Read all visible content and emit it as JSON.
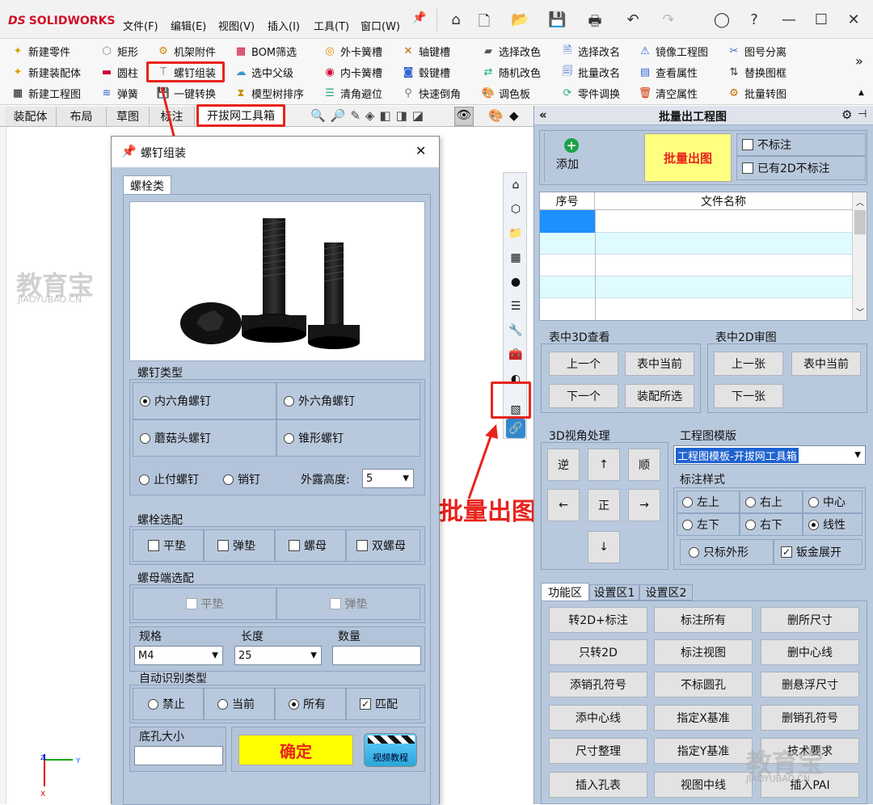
{
  "app": {
    "logo": "SOLIDWORKS",
    "logo_prefix": "DS"
  },
  "menu": [
    "文件(F)",
    "编辑(E)",
    "视图(V)",
    "插入(I)",
    "工具(T)",
    "窗口(W)"
  ],
  "ribbon": {
    "col1": [
      "新建零件",
      "新建装配体",
      "新建工程图"
    ],
    "col2": [
      "矩形",
      "圆柱",
      "弹簧"
    ],
    "col3": [
      "机架附件",
      "螺钉组装",
      "一键转换"
    ],
    "col4": [
      "BOM筛选",
      "选中父级",
      "模型树排序"
    ],
    "col5": [
      "外卡簧槽",
      "内卡簧槽",
      "清角避位"
    ],
    "col6": [
      "轴键槽",
      "毂键槽",
      "快速倒角"
    ],
    "col7": [
      "选择改色",
      "随机改色",
      "调色板"
    ],
    "col8": [
      "选择改名",
      "批量改名",
      "零件调换"
    ],
    "col9": [
      "镜像工程图",
      "查看属性",
      "清空属性"
    ],
    "col10": [
      "图号分离",
      "替换图框",
      "批量转图"
    ],
    "more": "»"
  },
  "tabs": [
    "装配体",
    "布局",
    "草图",
    "标注",
    "开拔网工具箱"
  ],
  "dialog": {
    "title": "螺钉组装",
    "close": "✕",
    "tab": "螺栓类",
    "screw_type_title": "螺钉类型",
    "screw_types": [
      "内六角螺钉",
      "外六角螺钉",
      "蘑菇头螺钉",
      "锥形螺钉",
      "止付螺钉",
      "销钉"
    ],
    "expose_label": "外露高度:",
    "expose_value": "5",
    "bolt_opts_title": "螺栓选配",
    "bolt_opts": [
      "平垫",
      "弹垫",
      "螺母",
      "双螺母"
    ],
    "nut_opts_title": "螺母端选配",
    "nut_opts": [
      "平垫",
      "弹垫"
    ],
    "spec_label": "规格",
    "spec_value": "M4",
    "length_label": "长度",
    "length_value": "25",
    "qty_label": "数量",
    "qty_value": "",
    "auto_title": "自动识别类型",
    "auto_opts": [
      "禁止",
      "当前",
      "所有",
      "匹配"
    ],
    "hole_label": "底孔大小",
    "hole_value": "",
    "ok": "确定",
    "video": "视频教程"
  },
  "annotation": {
    "batch": "批量出图"
  },
  "watermark": {
    "main": "教育宝",
    "sub": "JIAOYUBAO.CN"
  },
  "panel": {
    "title": "批量出工程图",
    "collapse": "«",
    "add": "添加",
    "batch": "批量出图",
    "chk_no_mark": "不标注",
    "chk_has2d": "已有2D不标注",
    "table_headers": [
      "序号",
      "文件名称"
    ],
    "view3d_title": "表中3D查看",
    "view3d_btns": [
      "上一个",
      "表中当前",
      "下一个",
      "装配所选"
    ],
    "review2d_title": "表中2D审图",
    "review2d_btns": [
      "上一张",
      "表中当前",
      "下一张"
    ],
    "angle_title": "3D视角处理",
    "angle_btns": [
      "逆",
      "↑",
      "顺",
      "←",
      "正",
      "→",
      "↓"
    ],
    "tpl_title": "工程图模版",
    "tpl_value": "工程图模板-开拔网工具箱",
    "style_title": "标注样式",
    "style_opts": [
      "左上",
      "右上",
      "中心",
      "左下",
      "右下",
      "线性"
    ],
    "only_outer": "只标外形",
    "sheet_unfold": "钣金展开",
    "func_tabs": [
      "功能区",
      "设置区1",
      "设置区2"
    ],
    "func_btns": [
      "转2D+标注",
      "标注所有",
      "删所尺寸",
      "只转2D",
      "标注视图",
      "删中心线",
      "添销孔符号",
      "不标圆孔",
      "删悬浮尺寸",
      "添中心线",
      "指定X基准",
      "删销孔符号",
      "尺寸整理",
      "指定Y基准",
      "技术要求",
      "插入孔表",
      "视图中线",
      "插入PAI"
    ]
  },
  "colors": {
    "accent_red": "#e8231c",
    "panel_bg": "#b9c9dd",
    "ok_yellow": "#ffff00"
  }
}
